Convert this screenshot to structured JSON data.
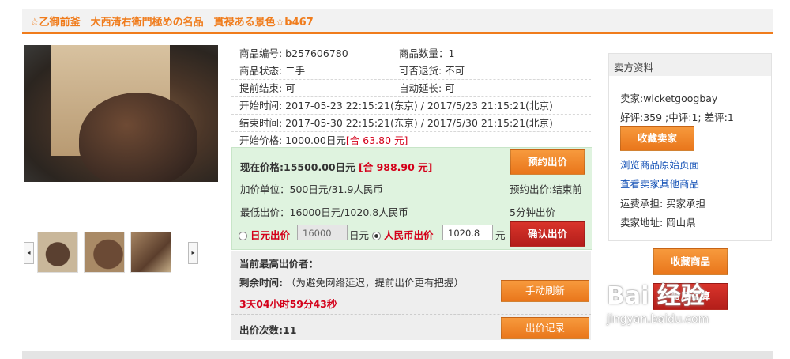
{
  "title": "☆乙御前釜　大西清右衛門極めの名品　貫禄ある景色☆b467",
  "info": {
    "item_no": "商品编号: b257606780",
    "quantity": "商品数量：1",
    "condition": "商品状态: 二手",
    "returnable": "可否退货: 不可",
    "early_end": "提前结束: 可",
    "auto_extend": "自动延长: 可",
    "start_time": "开始时间: 2017-05-23 22:15:21(东京) / 2017/5/23 21:15:21(北京)",
    "end_time": "结束时间: 2017-05-30 22:15:21(东京) / 2017/5/30 21:15:21(北京)",
    "start_price_label": "开始价格: 1000.00日元",
    "start_price_rmb": "[合 63.80 元]"
  },
  "price": {
    "current_label": "现在价格:15500.00日元",
    "current_rmb": "[合 988.90 元]",
    "reserve_bid_button": "预约出价",
    "increment": "加价单位：500日元/31.9人民币",
    "reserve_status": "预约出价:结束前",
    "min_bid": "最低出价：16000日元/1020.8人民币",
    "minutes": "5分钟出价",
    "yen_bid_label": "日元出价",
    "yen_value": "16000",
    "yen_unit": "日元",
    "rmb_bid_label": "人民币出价",
    "rmb_value": "1020.8",
    "rmb_unit": "元",
    "confirm_button": "确认出价"
  },
  "bid": {
    "top_bidder_label": "当前最高出价者：",
    "remaining_label": "剩余时间:",
    "remaining_note": "（为避免网络延迟，提前出价更有把握）",
    "countdown": "3天04小时59分43秒",
    "refresh_button": "手动刷新",
    "count_label": "出价次数:11",
    "history_button": "出价记录"
  },
  "seller": {
    "header": "卖方资料",
    "name": "卖家:wicketgoogbay",
    "rating": "好评:359 ;中评:1; 差评:1",
    "favorite_seller_button": "收藏卖家",
    "link_original": "浏览商品原始页面",
    "link_other": "查看卖家其他商品",
    "shipping": "运费承担: 买家承担",
    "location": "卖家地址: 岡山県"
  },
  "actions": {
    "favorite_item_button": "收藏商品",
    "usage_fee_button": "费用试算"
  },
  "watermark": {
    "logo": "Bai 经验",
    "url": "jingyan.baidu.com"
  },
  "colors": {
    "accent": "#f07c1c",
    "price_red": "#d4001a",
    "panel_green": "#dff3df",
    "link_blue": "#1a56b8"
  }
}
